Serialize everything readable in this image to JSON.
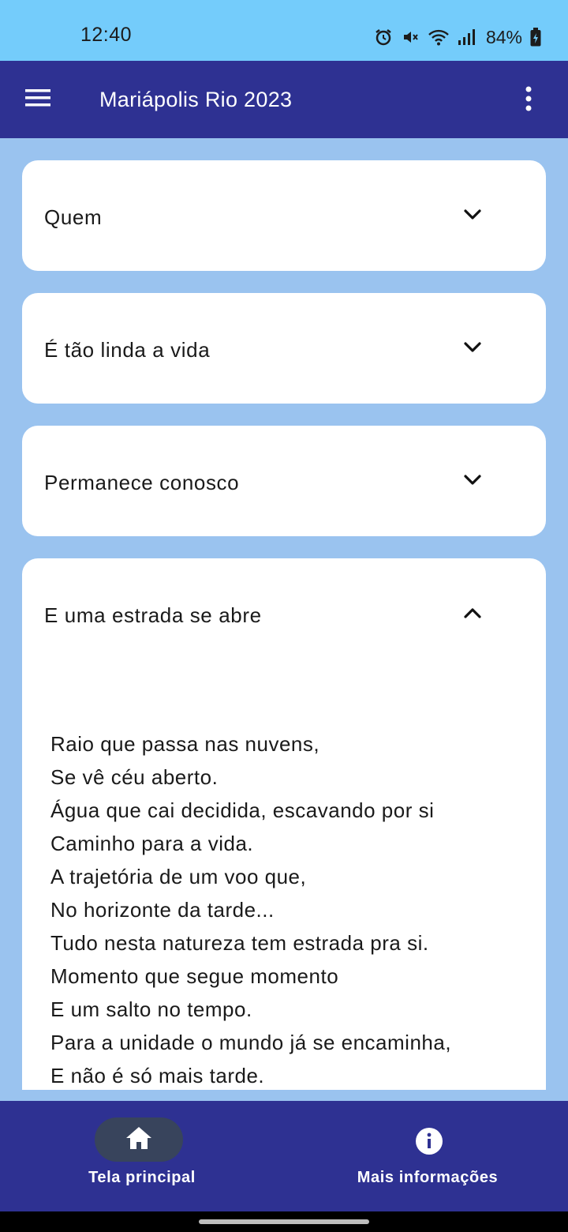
{
  "status_bar": {
    "time": "12:40",
    "battery": "84%",
    "icons": [
      "alarm-icon",
      "mute-icon",
      "wifi-icon",
      "signal-icon",
      "battery-icon"
    ]
  },
  "app_bar": {
    "title": "Mariápolis Rio 2023",
    "background": "#2e3192"
  },
  "songs": [
    {
      "title": "Quem",
      "expanded": false
    },
    {
      "title": "É tão linda a vida",
      "expanded": false
    },
    {
      "title": "Permanece conosco",
      "expanded": false
    },
    {
      "title": "E uma estrada se abre",
      "expanded": true,
      "lyrics": [
        "Raio que passa nas nuvens,",
        "Se vê céu aberto.",
        "Água que cai decidida, escavando por si",
        "Caminho para a vida.",
        "A trajetória de um voo que,",
        "No horizonte da tarde...",
        "Tudo nesta natureza tem estrada pra si.",
        "Momento que segue momento",
        "E um salto no tempo.",
        "Para a unidade o mundo já se encaminha,",
        "E não é só mais tarde."
      ]
    }
  ],
  "bottom_nav": {
    "items": [
      {
        "label": "Tela principal",
        "icon": "home-icon",
        "active": true
      },
      {
        "label": "Mais informações",
        "icon": "info-icon",
        "active": false
      }
    ]
  },
  "colors": {
    "status_bar": "#74ccfb",
    "page_background": "#9ac3ef",
    "card": "#ffffff",
    "active_pill": "#38445c"
  }
}
